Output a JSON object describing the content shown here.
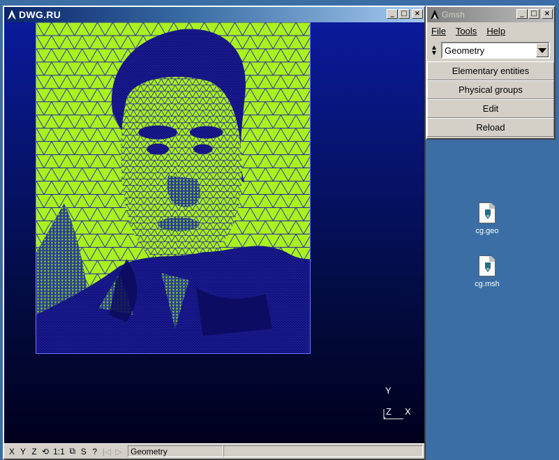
{
  "graphic_window": {
    "title": "DWG.RU",
    "minimize": "_",
    "maximize": "□",
    "close": "×"
  },
  "axes": {
    "x": "X",
    "y": "Y",
    "z": "Z"
  },
  "statusbar": {
    "btn_x": "X",
    "btn_y": "Y",
    "btn_z": "Z",
    "btn_rotate": "⟲",
    "btn_scale": "1:1",
    "btn_orthographic": "⧉",
    "btn_s": "S",
    "btn_help": "?",
    "btn_first": "|◁",
    "btn_play": "▷",
    "module": "Geometry"
  },
  "gmsh_window": {
    "title": "Gmsh",
    "minimize": "_",
    "maximize": "□",
    "close": "×",
    "menu": {
      "file": "File",
      "tools": "Tools",
      "help": "Help"
    },
    "module_selected": "Geometry",
    "buttons": {
      "elementary": "Elementary entities",
      "physical": "Physical groups",
      "edit": "Edit",
      "reload": "Reload"
    }
  },
  "desktop": {
    "icon1": "cg.geo",
    "icon2": "cg.msh"
  },
  "colors": {
    "mesh_fill": "#a9f11f",
    "mesh_lines": "#1c1ca0",
    "canvas_top": "#0a1a9a",
    "canvas_bottom": "#00001c",
    "desktop": "#3a6ea5"
  }
}
